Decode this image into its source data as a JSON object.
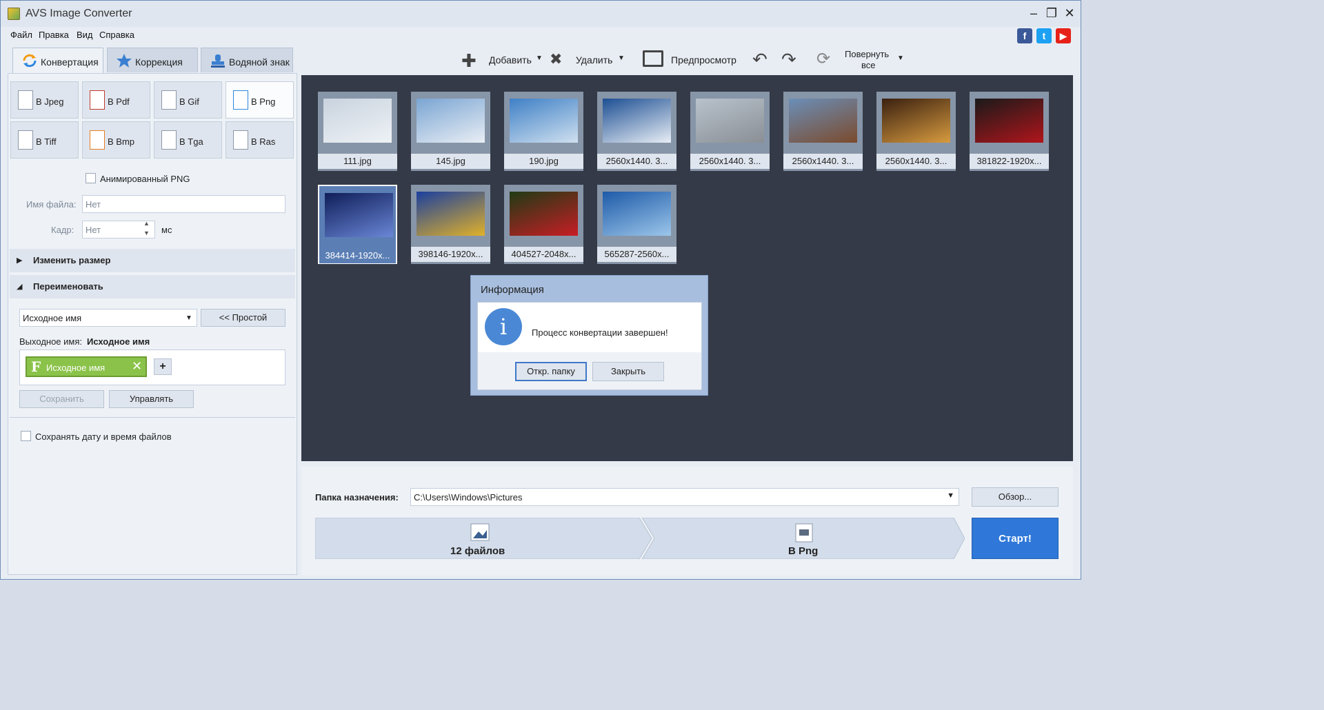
{
  "window": {
    "title": "AVS Image Converter"
  },
  "menu": [
    "Файл",
    "Правка",
    "Вид",
    "Справка"
  ],
  "social": [
    {
      "name": "facebook-icon",
      "glyph": "f",
      "color": "#3b5998"
    },
    {
      "name": "twitter-icon",
      "glyph": "t",
      "color": "#1da1f2"
    },
    {
      "name": "youtube-icon",
      "glyph": "▶",
      "color": "#e62117"
    }
  ],
  "tabs": [
    {
      "label": "Конвертация",
      "icon": "convert-icon",
      "active": true
    },
    {
      "label": "Коррекция",
      "icon": "star-icon",
      "active": false
    },
    {
      "label": "Водяной знак",
      "icon": "stamp-icon",
      "active": false
    }
  ],
  "toolbar": {
    "add": "Добавить",
    "delete": "Удалить",
    "preview": "Предпросмотр",
    "rotate_line1": "Повернуть",
    "rotate_line2": "все"
  },
  "formats": [
    {
      "label": "В Jpeg",
      "active": false
    },
    {
      "label": "В Pdf",
      "active": false
    },
    {
      "label": "В Gif",
      "active": false
    },
    {
      "label": "В Png",
      "active": true
    },
    {
      "label": "В Tiff",
      "active": false
    },
    {
      "label": "В Bmp",
      "active": false
    },
    {
      "label": "В Tga",
      "active": false
    },
    {
      "label": "В Ras",
      "active": false
    }
  ],
  "options": {
    "animated_png": "Анимированный PNG",
    "filename_label": "Имя файла:",
    "filename_value": "Нет",
    "frame_label": "Кадр:",
    "frame_value": "Нет",
    "frame_unit": "мс"
  },
  "resize": {
    "title": "Изменить размер"
  },
  "rename": {
    "title": "Переименовать",
    "mode": "Исходное имя",
    "simple_button": "<< Простой",
    "output_label": "Выходное имя:",
    "output_value": "Исходное имя",
    "token_letter": "F",
    "token_label": "Исходное имя",
    "add_token": "+",
    "save": "Сохранить",
    "manage": "Управлять"
  },
  "keep_date": "Сохранять дату и время файлов",
  "thumbnails": [
    {
      "caption": "111.jpg",
      "selected": false,
      "colors": [
        "#c9d3de",
        "#eef2f6"
      ]
    },
    {
      "caption": "145.jpg",
      "selected": false,
      "colors": [
        "#7aa5d3",
        "#e9eef4"
      ]
    },
    {
      "caption": "190.jpg",
      "selected": false,
      "colors": [
        "#3f80c6",
        "#cfe0ef"
      ]
    },
    {
      "caption": "2560x1440. 3...",
      "selected": false,
      "colors": [
        "#1d4f93",
        "#e8eef5"
      ]
    },
    {
      "caption": "2560x1440. 3...",
      "selected": false,
      "colors": [
        "#b8c2cc",
        "#8a8f95"
      ]
    },
    {
      "caption": "2560x1440. 3...",
      "selected": false,
      "colors": [
        "#6b8fb8",
        "#7b4a2c"
      ]
    },
    {
      "caption": "2560x1440. 3...",
      "selected": false,
      "colors": [
        "#3a2010",
        "#d79b3f"
      ]
    },
    {
      "caption": "381822-1920x...",
      "selected": false,
      "colors": [
        "#1a1a1a",
        "#b0151b"
      ]
    },
    {
      "caption": "384414-1920x...",
      "selected": true,
      "colors": [
        "#0f1e58",
        "#6a86d6"
      ]
    },
    {
      "caption": "398146-1920x...",
      "selected": false,
      "colors": [
        "#1b3f9e",
        "#e0b12a"
      ]
    },
    {
      "caption": "404527-2048x...",
      "selected": false,
      "colors": [
        "#1f3b14",
        "#c81d25"
      ]
    },
    {
      "caption": "565287-2560x...",
      "selected": false,
      "colors": [
        "#1d5aa8",
        "#9cc6ea"
      ]
    }
  ],
  "dialog": {
    "title": "Информация",
    "message": "Процесс конвертации завершен!",
    "open_folder": "Откр. папку",
    "close": "Закрыть",
    "icon": "info-icon",
    "icon_glyph": "i"
  },
  "output": {
    "dest_label": "Папка назначения:",
    "dest_path": "C:\\Users\\Windows\\Pictures",
    "browse": "Обзор...",
    "files_count": "12 файлов",
    "target": "В Png",
    "start": "Старт!"
  }
}
